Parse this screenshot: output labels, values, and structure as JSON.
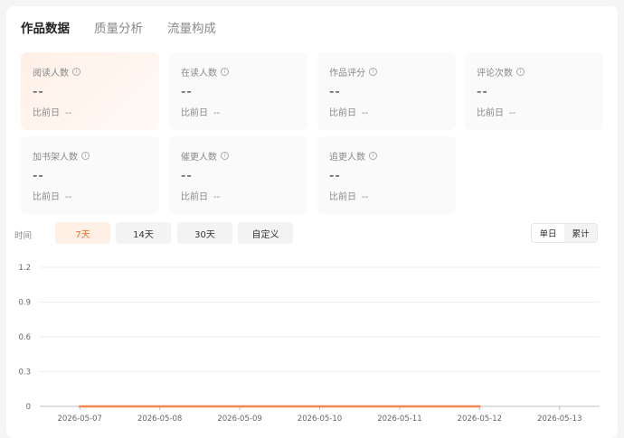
{
  "tabs": [
    {
      "label": "作品数据",
      "active": true
    },
    {
      "label": "质量分析",
      "active": false
    },
    {
      "label": "流量构成",
      "active": false
    }
  ],
  "metrics": [
    {
      "label": "阅读人数",
      "value": "--",
      "compare_label": "比前日",
      "compare_value": "--"
    },
    {
      "label": "在读人数",
      "value": "--",
      "compare_label": "比前日",
      "compare_value": "--"
    },
    {
      "label": "作品评分",
      "value": "--",
      "compare_label": "比前日",
      "compare_value": "--"
    },
    {
      "label": "评论次数",
      "value": "--",
      "compare_label": "比前日",
      "compare_value": "--"
    },
    {
      "label": "加书架人数",
      "value": "--",
      "compare_label": "比前日",
      "compare_value": "--"
    },
    {
      "label": "催更人数",
      "value": "--",
      "compare_label": "比前日",
      "compare_value": "--"
    },
    {
      "label": "追更人数",
      "value": "--",
      "compare_label": "比前日",
      "compare_value": "--"
    }
  ],
  "filters": {
    "time_label": "时间",
    "ranges": [
      {
        "label": "7天",
        "active": true
      },
      {
        "label": "14天",
        "active": false
      },
      {
        "label": "30天",
        "active": false
      },
      {
        "label": "自定义",
        "active": false
      }
    ],
    "modes": [
      {
        "label": "单日",
        "active": true
      },
      {
        "label": "累计",
        "active": false
      }
    ]
  },
  "colors": {
    "accent": "#f06a2b",
    "line": "#f4874f"
  },
  "chart_data": {
    "type": "line",
    "x": [
      "2026-05-07",
      "2026-05-08",
      "2026-05-09",
      "2026-05-10",
      "2026-05-11",
      "2026-05-12",
      "2026-05-13"
    ],
    "series": [
      {
        "values": [
          0,
          0,
          0,
          0,
          0,
          0,
          null
        ]
      }
    ],
    "ylim": [
      0,
      1.2
    ],
    "yticks": [
      "1.2",
      "0.9",
      "0.6",
      "0.3",
      "0"
    ],
    "grid": true
  }
}
